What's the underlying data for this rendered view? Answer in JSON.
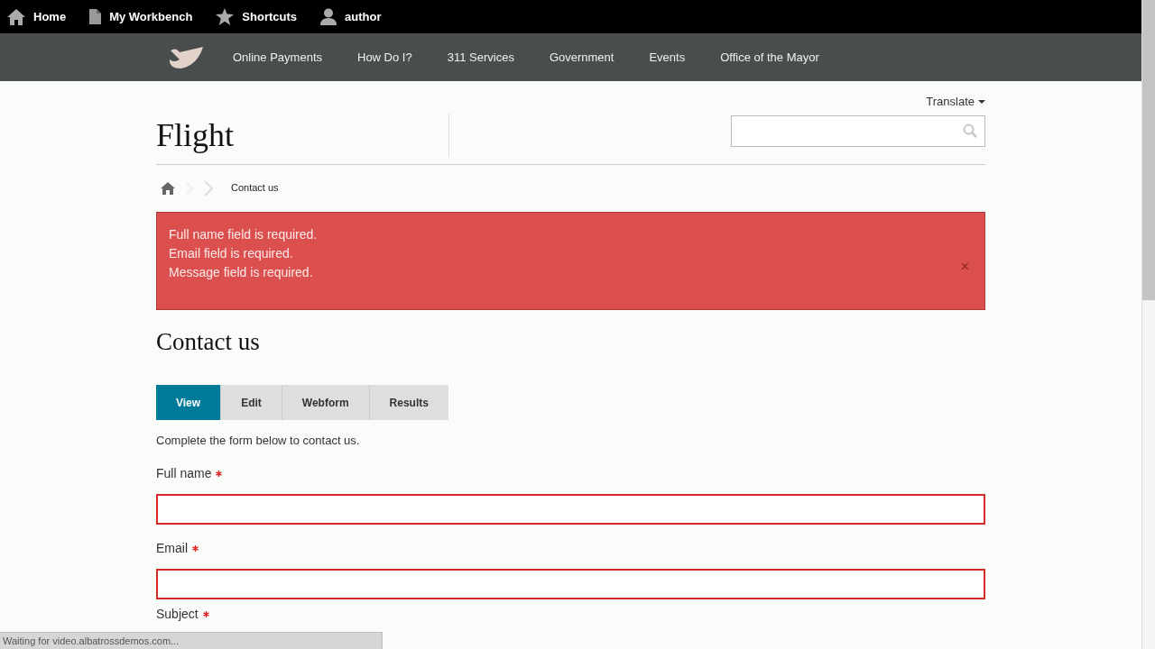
{
  "toolbar": {
    "items": [
      {
        "kind": "home",
        "label": "Home"
      },
      {
        "kind": "page",
        "label": "My Workbench"
      },
      {
        "kind": "star",
        "label": "Shortcuts"
      },
      {
        "kind": "user",
        "label": "author"
      }
    ]
  },
  "nav": {
    "items": [
      "Online Payments",
      "How Do I?",
      "311 Services",
      "Government",
      "Events",
      "Office of the Mayor"
    ]
  },
  "header": {
    "site_name": "Flight",
    "translate": "Translate"
  },
  "breadcrumb": {
    "current": "Contact us"
  },
  "alert": {
    "messages": [
      "Full name field is required.",
      "Email field is required.",
      "Message field is required."
    ],
    "close": "×"
  },
  "page_title": "Contact us",
  "tabs": [
    {
      "label": "View",
      "selected": true
    },
    {
      "label": "Edit",
      "selected": false
    },
    {
      "label": "Webform",
      "selected": false
    },
    {
      "label": "Results",
      "selected": false
    }
  ],
  "intro": "Complete the form below to contact us.",
  "fields": [
    {
      "label": "Full name",
      "required": true,
      "error": true
    },
    {
      "label": "Email",
      "required": true,
      "error": true
    }
  ],
  "next_label": {
    "label": "Subject",
    "required": true
  },
  "status_bar": "Waiting for video.albatrossdemos.com..."
}
